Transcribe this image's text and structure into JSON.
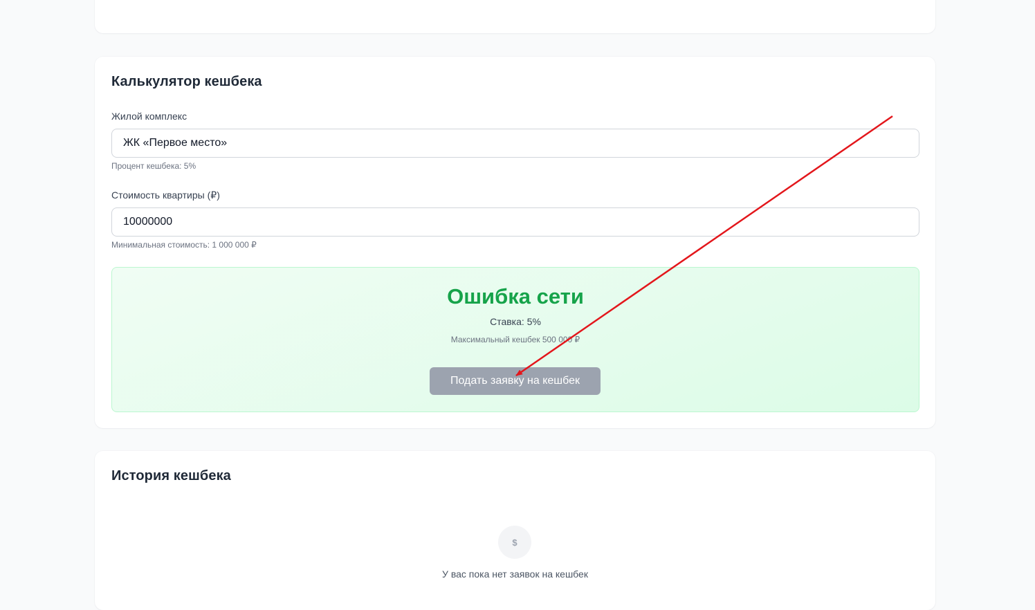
{
  "calculator": {
    "title": "Калькулятор кешбека",
    "complex_label": "Жилой комплекс",
    "complex_value": "ЖК «Первое место»",
    "complex_hint": "Процент кешбека: 5%",
    "price_label": "Стоимость квартиры (₽)",
    "price_value": "10000000",
    "price_hint": "Минимальная стоимость: 1 000 000 ₽",
    "result": {
      "amount": "Ошибка сети",
      "rate": "Ставка: 5%",
      "max": "Максимальный кешбек 500 000 ₽"
    },
    "submit_label": "Подать заявку на кешбек"
  },
  "history": {
    "title": "История кешбека",
    "empty_icon": "$",
    "empty_text": "У вас пока нет заявок на кешбек"
  },
  "colors": {
    "accent_green": "#16a34a",
    "disabled_button": "#9ca3af",
    "annotation_arrow": "#e3161b"
  },
  "icons": {
    "empty_state": "dollar-icon"
  }
}
